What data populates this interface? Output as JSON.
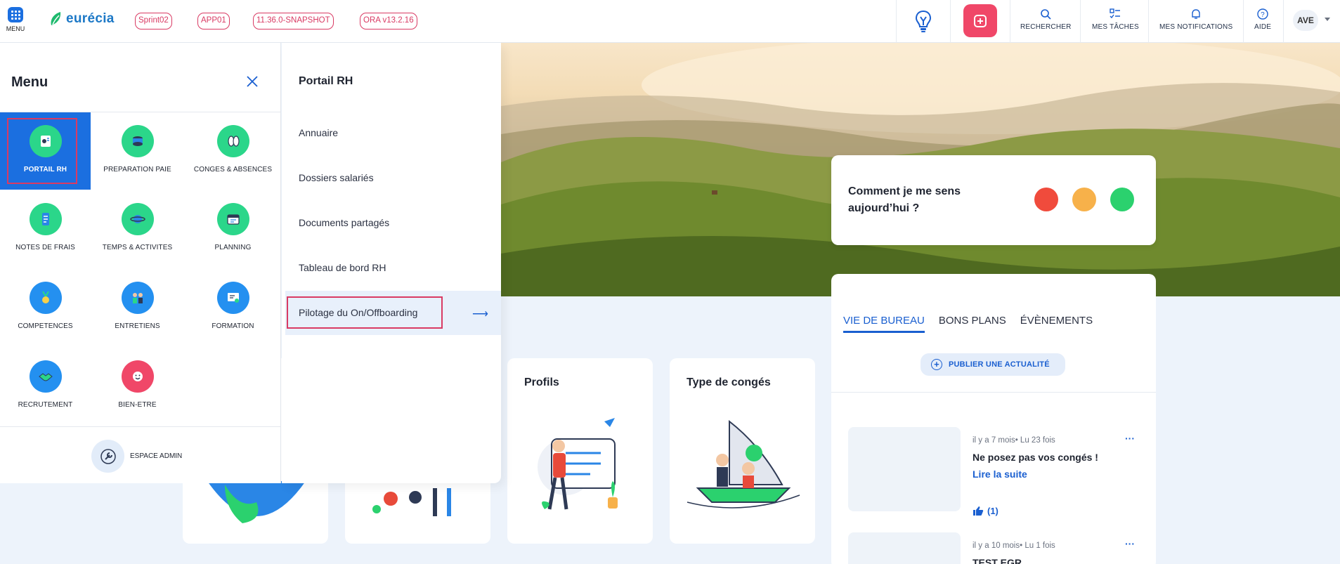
{
  "topbar": {
    "menu_label": "MENU",
    "logo_text": "eurécia",
    "tags": [
      "Sprint02",
      "APP01",
      "11.36.0-SNAPSHOT",
      "ORA v13.2.16"
    ],
    "search_label": "RECHERCHER",
    "tasks_label": "MES TÂCHES",
    "notifications_label": "MES NOTIFICATIONS",
    "help_label": "AIDE",
    "user_initials": "AVE"
  },
  "menu": {
    "title": "Menu",
    "tiles": [
      {
        "label": "PORTAIL RH",
        "icon": "portal-icon",
        "color": "#2bd68a"
      },
      {
        "label": "PREPARATION PAIE",
        "icon": "coins-icon",
        "color": "#2bd68a"
      },
      {
        "label": "CONGES & ABSENCES",
        "icon": "flip-flops-icon",
        "color": "#2bd68a"
      },
      {
        "label": "NOTES DE FRAIS",
        "icon": "receipt-icon",
        "color": "#2bd68a"
      },
      {
        "label": "TEMPS & ACTIVITES",
        "icon": "planet-icon",
        "color": "#2bd68a"
      },
      {
        "label": "PLANNING",
        "icon": "calendar-icon",
        "color": "#2bd68a"
      },
      {
        "label": "COMPETENCES",
        "icon": "medal-icon",
        "color": "#2490f0"
      },
      {
        "label": "ENTRETIENS",
        "icon": "meeting-icon",
        "color": "#2490f0"
      },
      {
        "label": "FORMATION",
        "icon": "board-icon",
        "color": "#2490f0"
      },
      {
        "label": "RECRUTEMENT",
        "icon": "handshake-icon",
        "color": "#2490f0"
      },
      {
        "label": "BIEN-ETRE",
        "icon": "smile-icon",
        "color": "#f04768"
      }
    ],
    "admin_label": "ESPACE ADMIN"
  },
  "submenu": {
    "title": "Portail RH",
    "items": [
      "Annuaire",
      "Dossiers salariés",
      "Documents partagés",
      "Tableau de bord RH",
      "Pilotage du On/Offboarding"
    ]
  },
  "mood": {
    "question": "Comment je me sens aujourd’hui ?"
  },
  "news": {
    "tabs": [
      "VIE DE BUREAU",
      "BONS PLANS",
      "ÉVÈNEMENTS"
    ],
    "publish_label": "PUBLIER UNE ACTUALITÉ",
    "posts": [
      {
        "meta": "il y a 7 mois• Lu 23 fois",
        "title": "Ne posez pas vos congés !",
        "link": "Lire la suite",
        "likes": "(1)"
      },
      {
        "meta": "il y a 10 mois• Lu 1 fois",
        "title": "TEST EGR"
      }
    ],
    "more": "···"
  },
  "cards": [
    {
      "title": "Profils"
    },
    {
      "title": "Type de congés"
    }
  ],
  "colors": {
    "brand_blue": "#1b6fe0",
    "accent_pink": "#d93a63",
    "plus_red": "#f04768"
  }
}
